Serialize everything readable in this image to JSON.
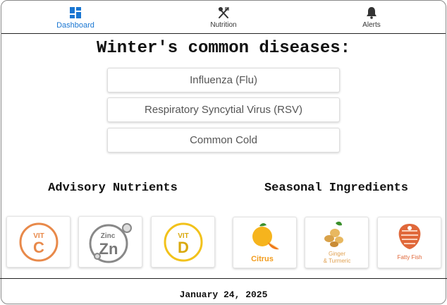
{
  "nav": {
    "items": [
      {
        "label": "Dashboard",
        "icon": "dashboard-icon",
        "active": true
      },
      {
        "label": "Nutrition",
        "icon": "utensils-icon",
        "active": false
      },
      {
        "label": "Alerts",
        "icon": "bell-icon",
        "active": false
      }
    ]
  },
  "main": {
    "title": "Winter's common diseases:",
    "diseases": [
      "Influenza (Flu)",
      "Respiratory Syncytial Virus (RSV)",
      "Common Cold"
    ]
  },
  "nutrients": {
    "heading": "Advisory Nutrients",
    "items": [
      {
        "top": "VIT",
        "letter": "C",
        "color": "#e8894a"
      },
      {
        "top": "Zinc",
        "letter": "Zn",
        "color": "#888888"
      },
      {
        "top": "VIT",
        "letter": "D",
        "color": "#f2c21b"
      }
    ]
  },
  "ingredients": {
    "heading": "Seasonal Ingredients",
    "items": [
      {
        "label": "Citrus",
        "color": "#f29b1b"
      },
      {
        "label_line1": "Ginger",
        "label_line2": "& Turmeric",
        "color": "#e0a050"
      },
      {
        "label": "Fatty Fish",
        "color": "#e0683a"
      }
    ]
  },
  "footer": {
    "date": "January 24, 2025"
  },
  "colors": {
    "accent": "#1976d2",
    "divider": "#222222"
  }
}
